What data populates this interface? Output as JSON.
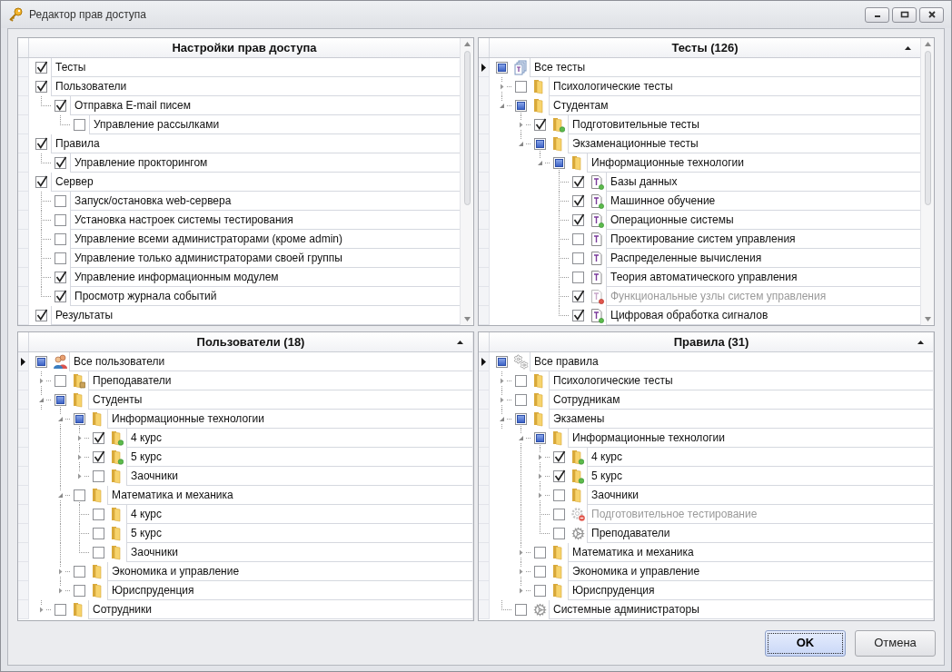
{
  "window": {
    "title": "Редактор прав доступа"
  },
  "panels": [
    {
      "title": "Настройки прав доступа",
      "sorted": false,
      "scrollbar": true,
      "items": [
        {
          "label": "Тесты",
          "checked": true
        },
        {
          "label": "Пользователи",
          "checked": true,
          "children": [
            {
              "label": "Отправка E-mail писем",
              "checked": true,
              "children": [
                {
                  "label": "Управление рассылками",
                  "checked": false
                }
              ]
            }
          ]
        },
        {
          "label": "Правила",
          "checked": true,
          "children": [
            {
              "label": "Управление прокторингом",
              "checked": true
            }
          ]
        },
        {
          "label": "Сервер",
          "checked": true,
          "children": [
            {
              "label": "Запуск/остановка web-сервера",
              "checked": false
            },
            {
              "label": "Установка настроек системы тестирования",
              "checked": false
            },
            {
              "label": "Управление всеми администраторами (кроме admin)",
              "checked": false
            },
            {
              "label": "Управление только администраторами своей группы",
              "checked": false
            },
            {
              "label": "Управление информационным модулем",
              "checked": true
            },
            {
              "label": "Просмотр журнала событий",
              "checked": true
            }
          ]
        },
        {
          "label": "Результаты",
          "checked": true
        }
      ]
    },
    {
      "title": "Тесты (126)",
      "sorted": true,
      "scrollbar": true,
      "items": [
        {
          "label": "Все тесты",
          "checked": false,
          "mixed": true,
          "kind": "tests",
          "focused": true,
          "children": [
            {
              "label": "Психологические тесты",
              "checked": false,
              "mixed": false,
              "kind": "folder",
              "expanded": false
            },
            {
              "label": "Студентам",
              "checked": false,
              "mixed": true,
              "kind": "folder",
              "expanded": true,
              "children": [
                {
                  "label": "Подготовительные тесты",
                  "checked": true,
                  "kind": "folder-ok",
                  "expanded": false
                },
                {
                  "label": "Экзаменационные тесты",
                  "checked": false,
                  "mixed": true,
                  "kind": "folder",
                  "expanded": true,
                  "children": [
                    {
                      "label": "Информационные технологии",
                      "checked": false,
                      "mixed": true,
                      "kind": "folder",
                      "expanded": true,
                      "children": [
                        {
                          "label": "Базы данных",
                          "checked": true,
                          "kind": "test-ok",
                          "disabled": false
                        },
                        {
                          "label": "Машинное обучение",
                          "checked": true,
                          "kind": "test-ok",
                          "disabled": false
                        },
                        {
                          "label": "Операционные системы",
                          "checked": true,
                          "kind": "test-ok",
                          "disabled": false
                        },
                        {
                          "label": "Проектирование систем управления",
                          "checked": false,
                          "kind": "test",
                          "disabled": false
                        },
                        {
                          "label": "Распределенные вычисления",
                          "checked": false,
                          "kind": "test",
                          "disabled": false
                        },
                        {
                          "label": "Теория автоматического управления",
                          "checked": false,
                          "kind": "test",
                          "disabled": false
                        },
                        {
                          "label": "Функциональные узлы систем управления",
                          "checked": true,
                          "kind": "test-blocked",
                          "disabled": true
                        },
                        {
                          "label": "Цифровая обработка сигналов",
                          "checked": true,
                          "kind": "test-ok",
                          "disabled": false
                        }
                      ]
                    }
                  ]
                }
              ]
            }
          ]
        }
      ]
    },
    {
      "title": "Пользователи (18)",
      "sorted": true,
      "scrollbar": false,
      "items": [
        {
          "label": "Все пользователи",
          "checked": false,
          "mixed": true,
          "kind": "users",
          "focused": true,
          "children": [
            {
              "label": "Преподаватели",
              "checked": false,
              "mixed": false,
              "kind": "folder-lock",
              "expanded": false
            },
            {
              "label": "Студенты",
              "checked": false,
              "mixed": true,
              "kind": "folder",
              "expanded": true,
              "children": [
                {
                  "label": "Информационные технологии",
                  "checked": false,
                  "mixed": true,
                  "kind": "folder",
                  "expanded": true,
                  "children": [
                    {
                      "label": "4 курс",
                      "checked": true,
                      "kind": "folder-ok",
                      "expanded": false
                    },
                    {
                      "label": "5 курс",
                      "checked": true,
                      "kind": "folder-ok",
                      "expanded": false
                    },
                    {
                      "label": "Заочники",
                      "checked": false,
                      "kind": "folder",
                      "expanded": false
                    }
                  ]
                },
                {
                  "label": "Математика и механика",
                  "checked": false,
                  "mixed": false,
                  "kind": "folder",
                  "expanded": true,
                  "children": [
                    {
                      "label": "4 курс",
                      "checked": false,
                      "kind": "folder"
                    },
                    {
                      "label": "5 курс",
                      "checked": false,
                      "kind": "folder"
                    },
                    {
                      "label": "Заочники",
                      "checked": false,
                      "kind": "folder"
                    }
                  ]
                },
                {
                  "label": "Экономика и управление",
                  "checked": false,
                  "mixed": false,
                  "kind": "folder",
                  "expanded": false
                },
                {
                  "label": "Юриспруденция",
                  "checked": false,
                  "mixed": false,
                  "kind": "folder",
                  "expanded": false
                }
              ]
            },
            {
              "label": "Сотрудники",
              "checked": false,
              "mixed": false,
              "kind": "folder",
              "expanded": false
            }
          ]
        }
      ]
    },
    {
      "title": "Правила (31)",
      "sorted": true,
      "scrollbar": false,
      "items": [
        {
          "label": "Все правила",
          "checked": false,
          "mixed": true,
          "kind": "gears",
          "focused": true,
          "children": [
            {
              "label": "Психологические тесты",
              "checked": false,
              "mixed": false,
              "kind": "folder",
              "expanded": false
            },
            {
              "label": "Сотрудникам",
              "checked": false,
              "mixed": false,
              "kind": "folder",
              "expanded": false
            },
            {
              "label": "Экзамены",
              "checked": false,
              "mixed": true,
              "kind": "folder",
              "expanded": true,
              "children": [
                {
                  "label": "Информационные технологии",
                  "checked": false,
                  "mixed": true,
                  "kind": "folder",
                  "expanded": true,
                  "children": [
                    {
                      "label": "4 курс",
                      "checked": true,
                      "kind": "folder-ok",
                      "expanded": false,
                      "disabled": false
                    },
                    {
                      "label": "5 курс",
                      "checked": true,
                      "kind": "folder-ok",
                      "expanded": false,
                      "disabled": false
                    },
                    {
                      "label": "Заочники",
                      "checked": false,
                      "kind": "folder",
                      "expanded": false,
                      "disabled": false
                    },
                    {
                      "label": "Подготовительное тестирование",
                      "checked": false,
                      "kind": "gear-blocked",
                      "disabled": true
                    },
                    {
                      "label": "Преподаватели",
                      "checked": false,
                      "kind": "gear",
                      "disabled": false
                    }
                  ]
                },
                {
                  "label": "Математика и механика",
                  "checked": false,
                  "mixed": false,
                  "kind": "folder",
                  "expanded": false
                },
                {
                  "label": "Экономика и управление",
                  "checked": false,
                  "mixed": false,
                  "kind": "folder",
                  "expanded": false
                },
                {
                  "label": "Юриспруденция",
                  "checked": false,
                  "mixed": false,
                  "kind": "folder",
                  "expanded": false
                }
              ]
            },
            {
              "label": "Системные администраторы",
              "checked": false,
              "mixed": false,
              "kind": "gear"
            }
          ]
        }
      ]
    }
  ],
  "buttons": [
    {
      "label": "OK",
      "default": true
    },
    {
      "label": "Отмена",
      "default": false
    }
  ]
}
